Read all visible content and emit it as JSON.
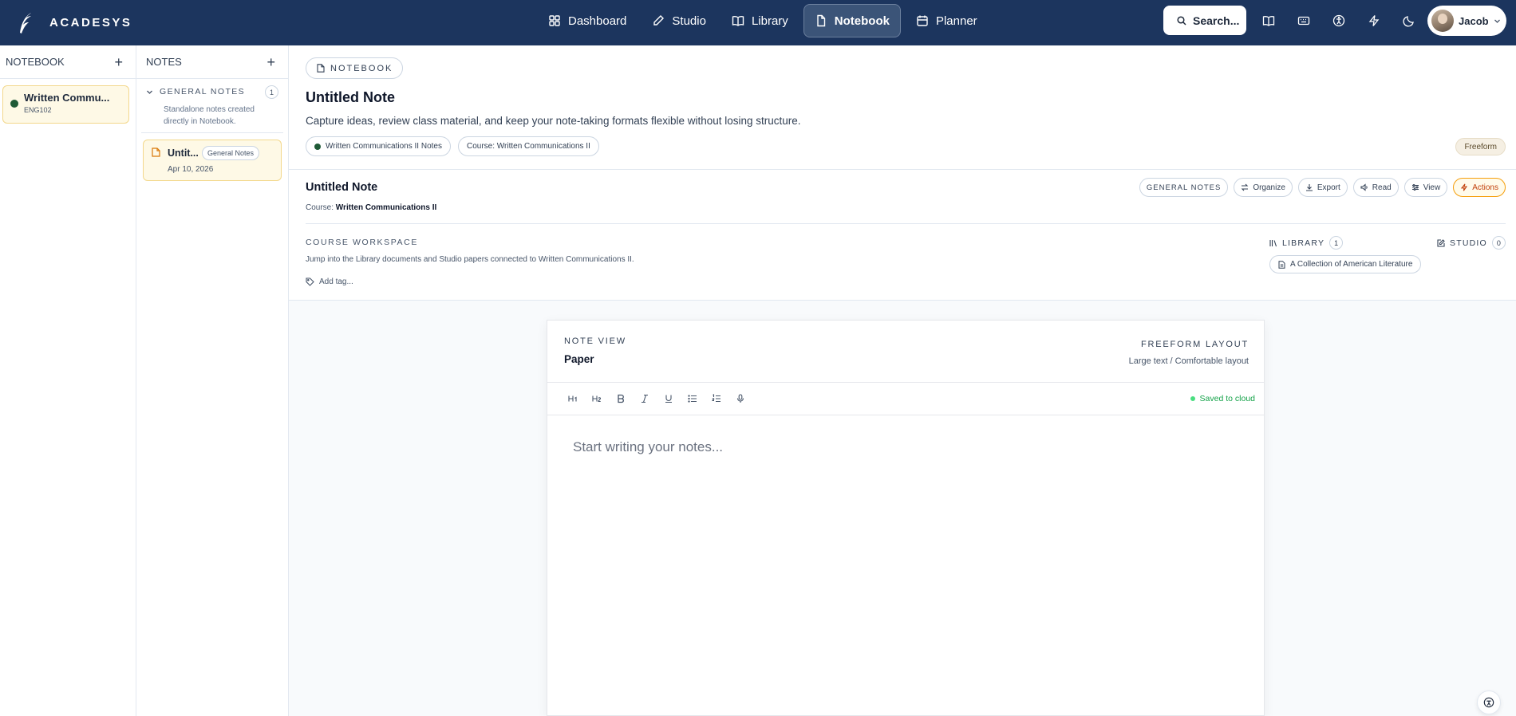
{
  "app": {
    "name": "ACADESYS"
  },
  "nav": [
    {
      "label": "Dashboard",
      "icon": "grid-icon",
      "active": false
    },
    {
      "label": "Studio",
      "icon": "pen-icon",
      "active": false
    },
    {
      "label": "Library",
      "icon": "book-icon",
      "active": false
    },
    {
      "label": "Notebook",
      "icon": "file-icon",
      "active": true
    },
    {
      "label": "Planner",
      "icon": "calendar-icon",
      "active": false
    }
  ],
  "search": {
    "label": "Search..."
  },
  "user": {
    "name": "Jacob"
  },
  "notebook_col": {
    "title": "NOTEBOOK",
    "add": "+",
    "items": [
      {
        "title": "Written Commu...",
        "code": "ENG102",
        "color": "#1f5a36"
      }
    ]
  },
  "notes_col": {
    "title": "NOTES",
    "add": "+",
    "group": {
      "title": "GENERAL NOTES",
      "count": "1",
      "desc": "Standalone notes created directly in Notebook."
    },
    "notes": [
      {
        "title": "Untit...",
        "badge": "General Notes",
        "date": "Apr 10, 2026"
      }
    ]
  },
  "header": {
    "pill": "NOTEBOOK",
    "title": "Untitled Note",
    "subtitle": "Capture ideas, review class material, and keep your note-taking formats flexible without losing structure.",
    "chips": [
      "Written Communications II Notes",
      "Course: Written Communications II"
    ],
    "layout_tag": "Freeform"
  },
  "meta": {
    "title": "Untitled Note",
    "course_prefix": "Course:",
    "course": "Written Communications II",
    "actions": {
      "tag": "GENERAL NOTES",
      "organize": "Organize",
      "export": "Export",
      "read": "Read",
      "view": "View",
      "actions": "Actions"
    },
    "workspace_label": "COURSE WORKSPACE",
    "workspace_desc": "Jump into the Library documents and Studio papers connected to Written Communications II.",
    "add_tag": "Add tag...",
    "library": {
      "label": "LIBRARY",
      "count": "1",
      "doc": "A Collection of American Literature"
    },
    "studio": {
      "label": "STUDIO",
      "count": "0"
    }
  },
  "paper": {
    "view_label": "NOTE VIEW",
    "view_name": "Paper",
    "layout_label": "FREEFORM LAYOUT",
    "layout_desc": "Large text / Comfortable layout",
    "toolbar": {
      "h1": "H1",
      "h2": "H2"
    },
    "saved": "Saved to cloud",
    "placeholder": "Start writing your notes..."
  },
  "colors": {
    "topbar": "#1c355e",
    "accent": "#f59e0b",
    "saved": "#16a34a"
  }
}
